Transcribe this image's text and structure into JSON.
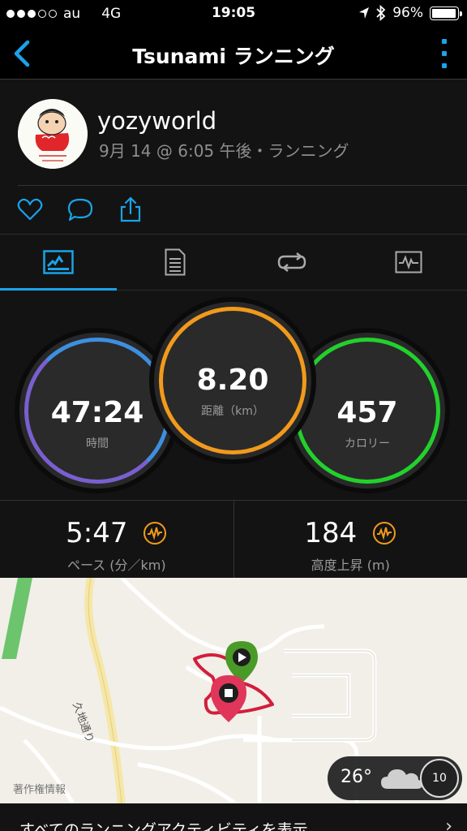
{
  "status_bar": {
    "carrier": "au",
    "network": "4G",
    "time": "19:05",
    "battery": "96%",
    "signal_bars": 3,
    "signal_total": 5
  },
  "nav": {
    "title": "Tsunami ランニング"
  },
  "profile": {
    "username": "yozyworld",
    "subtitle": "9月 14 @ 6:05 午後・ランニング"
  },
  "tabs": [
    {
      "icon": "stats-icon",
      "active": true
    },
    {
      "icon": "details-icon",
      "active": false
    },
    {
      "icon": "laps-icon",
      "active": false
    },
    {
      "icon": "chart-icon",
      "active": false
    }
  ],
  "stats": {
    "time": {
      "value": "47:24",
      "label": "時間"
    },
    "distance": {
      "value": "8.20",
      "label": "距離（km）"
    },
    "calories": {
      "value": "457",
      "label": "カロリー"
    }
  },
  "sub_stats": {
    "pace": {
      "value": "5:47",
      "label": "ペース (分／km)"
    },
    "elevation": {
      "value": "184",
      "label": "高度上昇 (m)"
    }
  },
  "map": {
    "road_label": "久地通り",
    "copyright": "著作権情報",
    "weather": {
      "temperature": "26°",
      "icon": "cloud-icon"
    },
    "compass": "10"
  },
  "bottom_link": {
    "text": "すべてのランニングアクティビティを表示"
  },
  "colors": {
    "accent": "#1aa3e8",
    "time_ring": "#3d8fe0",
    "distance_ring": "#f29a1c",
    "calories_ring": "#22d12c",
    "wave_icon": "#f29a1c",
    "route": "#d21e3c"
  }
}
